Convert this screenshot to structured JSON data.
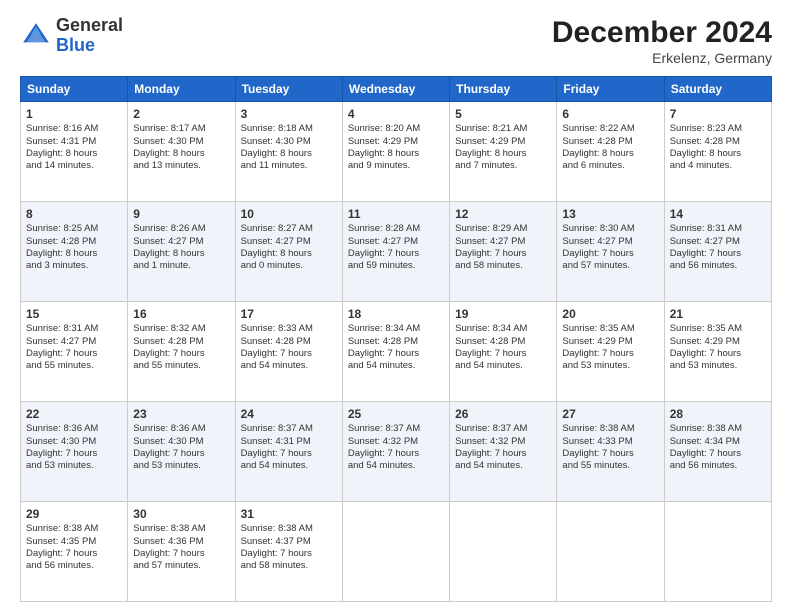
{
  "logo": {
    "general": "General",
    "blue": "Blue"
  },
  "header": {
    "month": "December 2024",
    "location": "Erkelenz, Germany"
  },
  "days": [
    "Sunday",
    "Monday",
    "Tuesday",
    "Wednesday",
    "Thursday",
    "Friday",
    "Saturday"
  ],
  "weeks": [
    [
      {
        "num": "1",
        "sunrise": "8:16 AM",
        "sunset": "4:31 PM",
        "daylight": "8 hours and 14 minutes."
      },
      {
        "num": "2",
        "sunrise": "8:17 AM",
        "sunset": "4:30 PM",
        "daylight": "8 hours and 13 minutes."
      },
      {
        "num": "3",
        "sunrise": "8:18 AM",
        "sunset": "4:30 PM",
        "daylight": "8 hours and 11 minutes."
      },
      {
        "num": "4",
        "sunrise": "8:20 AM",
        "sunset": "4:29 PM",
        "daylight": "8 hours and 9 minutes."
      },
      {
        "num": "5",
        "sunrise": "8:21 AM",
        "sunset": "4:29 PM",
        "daylight": "8 hours and 7 minutes."
      },
      {
        "num": "6",
        "sunrise": "8:22 AM",
        "sunset": "4:28 PM",
        "daylight": "8 hours and 6 minutes."
      },
      {
        "num": "7",
        "sunrise": "8:23 AM",
        "sunset": "4:28 PM",
        "daylight": "8 hours and 4 minutes."
      }
    ],
    [
      {
        "num": "8",
        "sunrise": "8:25 AM",
        "sunset": "4:28 PM",
        "daylight": "8 hours and 3 minutes."
      },
      {
        "num": "9",
        "sunrise": "8:26 AM",
        "sunset": "4:27 PM",
        "daylight": "8 hours and 1 minute."
      },
      {
        "num": "10",
        "sunrise": "8:27 AM",
        "sunset": "4:27 PM",
        "daylight": "8 hours and 0 minutes."
      },
      {
        "num": "11",
        "sunrise": "8:28 AM",
        "sunset": "4:27 PM",
        "daylight": "7 hours and 59 minutes."
      },
      {
        "num": "12",
        "sunrise": "8:29 AM",
        "sunset": "4:27 PM",
        "daylight": "7 hours and 58 minutes."
      },
      {
        "num": "13",
        "sunrise": "8:30 AM",
        "sunset": "4:27 PM",
        "daylight": "7 hours and 57 minutes."
      },
      {
        "num": "14",
        "sunrise": "8:31 AM",
        "sunset": "4:27 PM",
        "daylight": "7 hours and 56 minutes."
      }
    ],
    [
      {
        "num": "15",
        "sunrise": "8:31 AM",
        "sunset": "4:27 PM",
        "daylight": "7 hours and 55 minutes."
      },
      {
        "num": "16",
        "sunrise": "8:32 AM",
        "sunset": "4:28 PM",
        "daylight": "7 hours and 55 minutes."
      },
      {
        "num": "17",
        "sunrise": "8:33 AM",
        "sunset": "4:28 PM",
        "daylight": "7 hours and 54 minutes."
      },
      {
        "num": "18",
        "sunrise": "8:34 AM",
        "sunset": "4:28 PM",
        "daylight": "7 hours and 54 minutes."
      },
      {
        "num": "19",
        "sunrise": "8:34 AM",
        "sunset": "4:28 PM",
        "daylight": "7 hours and 54 minutes."
      },
      {
        "num": "20",
        "sunrise": "8:35 AM",
        "sunset": "4:29 PM",
        "daylight": "7 hours and 53 minutes."
      },
      {
        "num": "21",
        "sunrise": "8:35 AM",
        "sunset": "4:29 PM",
        "daylight": "7 hours and 53 minutes."
      }
    ],
    [
      {
        "num": "22",
        "sunrise": "8:36 AM",
        "sunset": "4:30 PM",
        "daylight": "7 hours and 53 minutes."
      },
      {
        "num": "23",
        "sunrise": "8:36 AM",
        "sunset": "4:30 PM",
        "daylight": "7 hours and 53 minutes."
      },
      {
        "num": "24",
        "sunrise": "8:37 AM",
        "sunset": "4:31 PM",
        "daylight": "7 hours and 54 minutes."
      },
      {
        "num": "25",
        "sunrise": "8:37 AM",
        "sunset": "4:32 PM",
        "daylight": "7 hours and 54 minutes."
      },
      {
        "num": "26",
        "sunrise": "8:37 AM",
        "sunset": "4:32 PM",
        "daylight": "7 hours and 54 minutes."
      },
      {
        "num": "27",
        "sunrise": "8:38 AM",
        "sunset": "4:33 PM",
        "daylight": "7 hours and 55 minutes."
      },
      {
        "num": "28",
        "sunrise": "8:38 AM",
        "sunset": "4:34 PM",
        "daylight": "7 hours and 56 minutes."
      }
    ],
    [
      {
        "num": "29",
        "sunrise": "8:38 AM",
        "sunset": "4:35 PM",
        "daylight": "7 hours and 56 minutes."
      },
      {
        "num": "30",
        "sunrise": "8:38 AM",
        "sunset": "4:36 PM",
        "daylight": "7 hours and 57 minutes."
      },
      {
        "num": "31",
        "sunrise": "8:38 AM",
        "sunset": "4:37 PM",
        "daylight": "7 hours and 58 minutes."
      },
      null,
      null,
      null,
      null
    ]
  ],
  "labels": {
    "sunrise": "Sunrise:",
    "sunset": "Sunset:",
    "daylight": "Daylight hours"
  }
}
